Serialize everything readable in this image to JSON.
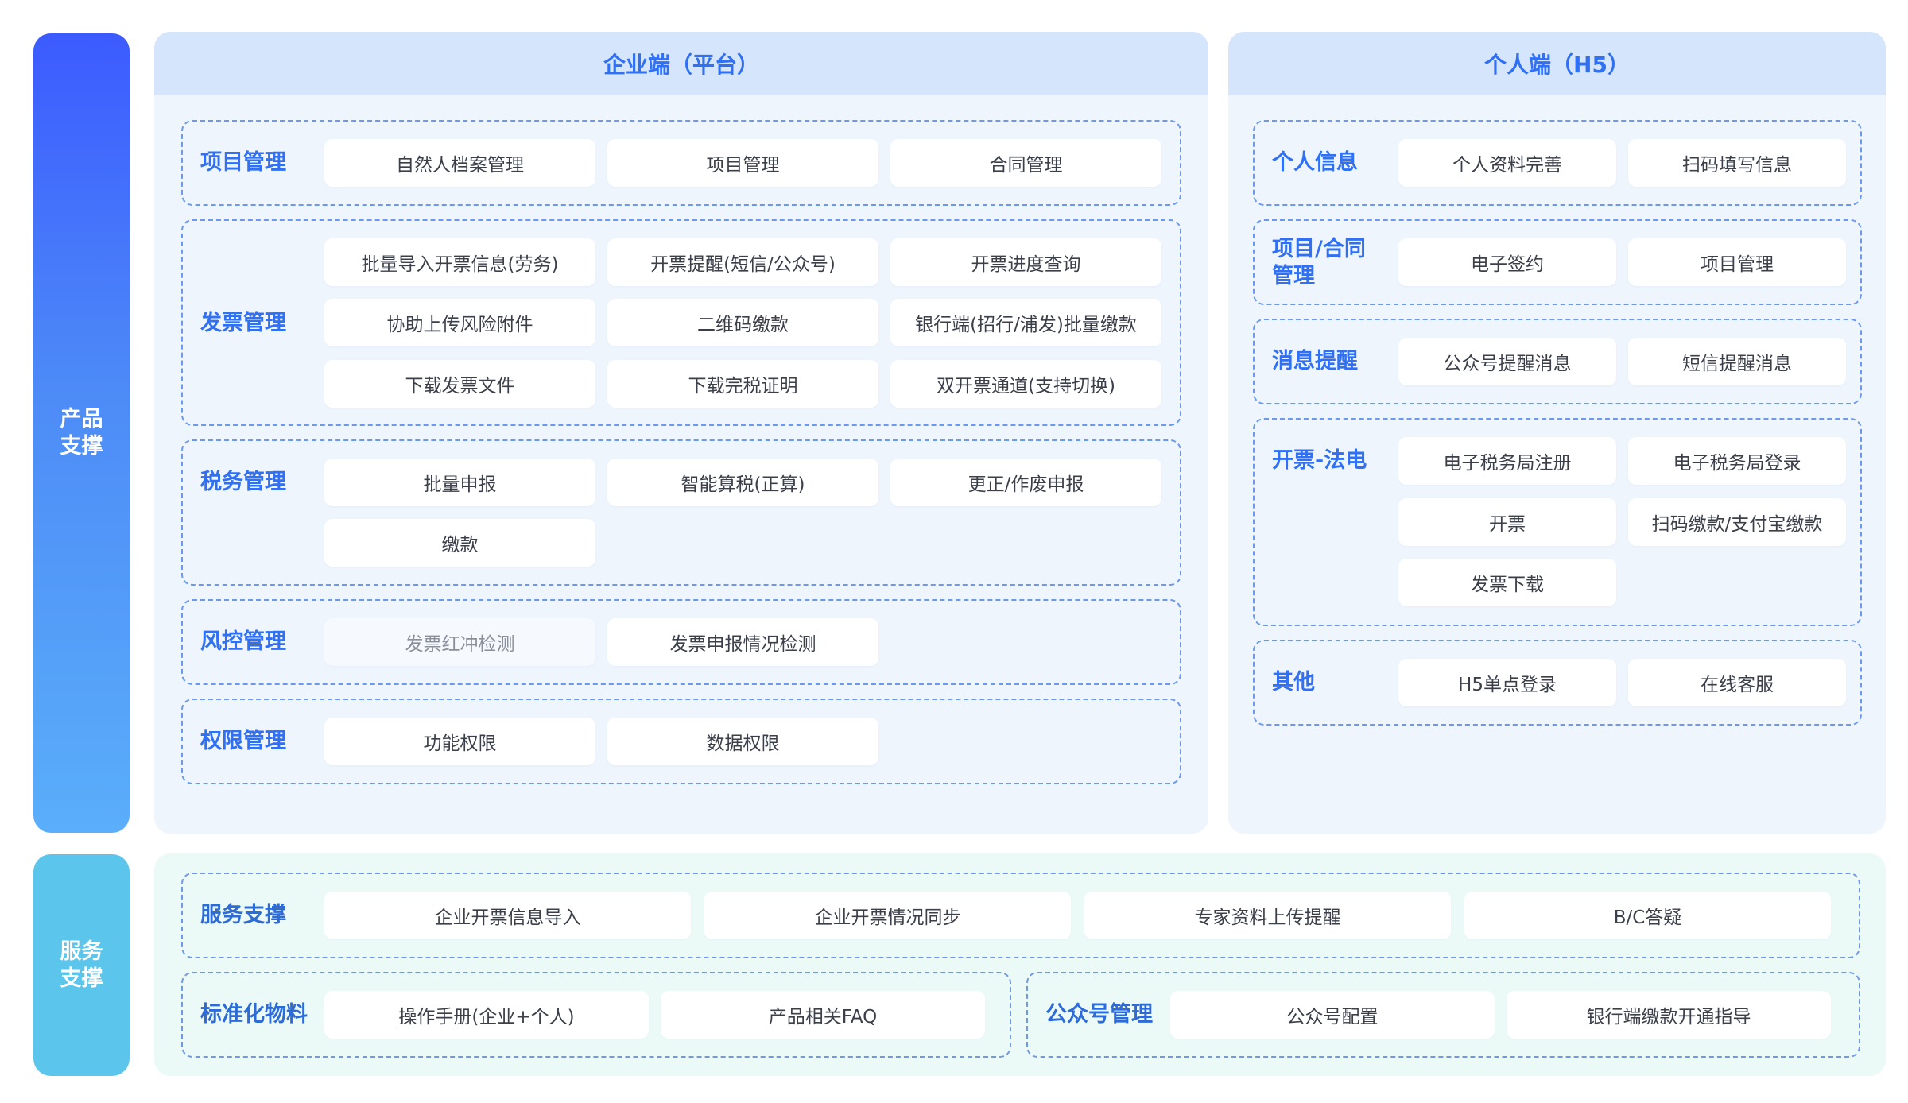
{
  "side": {
    "product": "产品\n支撑",
    "service": "服务\n支撑"
  },
  "enterprise": {
    "title": "企业端（平台）",
    "groups": [
      {
        "title": "项目管理",
        "items": [
          "自然人档案管理",
          "项目管理",
          "合同管理"
        ]
      },
      {
        "title": "发票管理",
        "items": [
          "批量导入开票信息(劳务)",
          "开票提醒(短信/公众号)",
          "开票进度查询",
          "协助上传风险附件",
          "二维码缴款",
          "银行端(招行/浦发)批量缴款",
          "下载发票文件",
          "下载完税证明",
          "双开票通道(支持切换)"
        ]
      },
      {
        "title": "税务管理",
        "items": [
          "批量申报",
          "智能算税(正算)",
          "更正/作废申报",
          "缴款"
        ]
      },
      {
        "title": "风控管理",
        "items": [
          "发票红冲检测",
          "发票申报情况检测"
        ]
      },
      {
        "title": "权限管理",
        "items": [
          "功能权限",
          "数据权限"
        ]
      }
    ]
  },
  "personal": {
    "title": "个人端（H5）",
    "groups": [
      {
        "title": "个人信息",
        "items": [
          "个人资料完善",
          "扫码填写信息"
        ]
      },
      {
        "title": "项目/合同\n管理",
        "items": [
          "电子签约",
          "项目管理"
        ]
      },
      {
        "title": "消息提醒",
        "items": [
          "公众号提醒消息",
          "短信提醒消息"
        ]
      },
      {
        "title": "开票-法电",
        "items": [
          "电子税务局注册",
          "电子税务局登录",
          "开票",
          "扫码缴款/支付宝缴款",
          "发票下载"
        ]
      },
      {
        "title": "其他",
        "items": [
          "H5单点登录",
          "在线客服"
        ]
      }
    ]
  },
  "service": {
    "groups": [
      {
        "title": "服务支撑",
        "items": [
          "企业开票信息导入",
          "企业开票情况同步",
          "专家资料上传提醒",
          "B/C答疑"
        ]
      },
      {
        "title": "标准化物料",
        "items": [
          "操作手册(企业+个人)",
          "产品相关FAQ"
        ]
      },
      {
        "title": "公众号管理",
        "items": [
          "公众号配置",
          "银行端缴款开通指导"
        ]
      }
    ]
  },
  "colors": {
    "accent": "#2f70f4",
    "panel_bg": "#eef5fd",
    "service_bg": "#ecfaf7",
    "side_product_top": "#3c5bff",
    "side_product_bottom": "#5aaefa",
    "side_service": "#5cc5ec"
  }
}
